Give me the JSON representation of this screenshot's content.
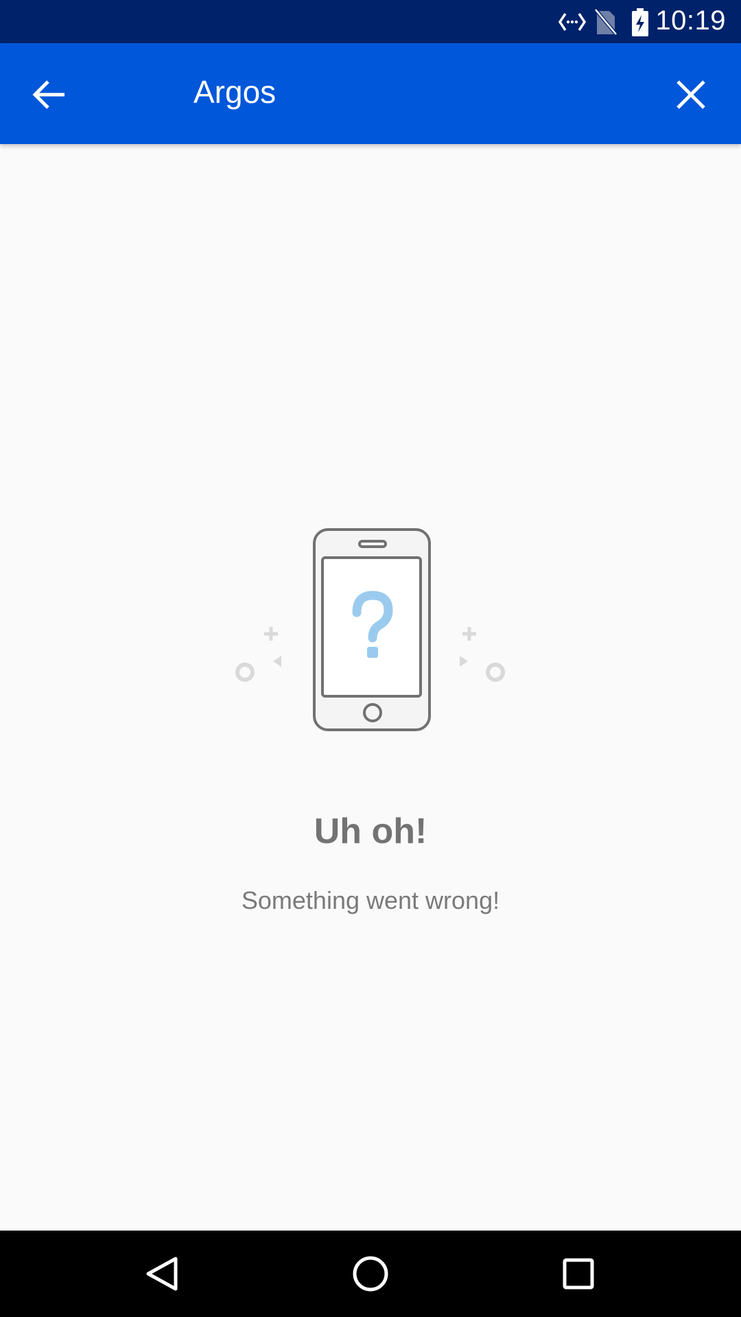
{
  "status_bar": {
    "time": "10:19",
    "icons": [
      "data-sync-icon",
      "no-sim-icon",
      "battery-charging-icon"
    ]
  },
  "app_bar": {
    "title": "Argos",
    "back_icon": "arrow-left-icon",
    "close_icon": "close-icon",
    "background_color": "#0057d9"
  },
  "error": {
    "illustration": "phone-question-icon",
    "title": "Uh oh!",
    "message": "Something went wrong!"
  },
  "nav_bar": {
    "buttons": [
      "back-triangle-icon",
      "home-circle-icon",
      "recents-square-icon"
    ]
  }
}
